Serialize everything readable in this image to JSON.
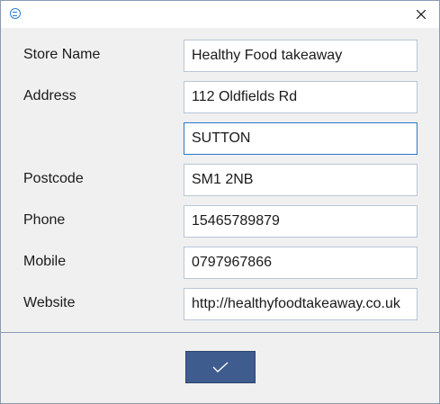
{
  "window": {
    "icon": "app-icon",
    "close_icon": "close-icon"
  },
  "form": {
    "store_name": {
      "label": "Store Name",
      "value": "Healthy Food takeaway"
    },
    "address": {
      "label": "Address",
      "value": "112 Oldfields Rd"
    },
    "address2": {
      "value": "SUTTON"
    },
    "postcode": {
      "label": "Postcode",
      "value": "SM1 2NB"
    },
    "phone": {
      "label": "Phone",
      "value": "15465789879"
    },
    "mobile": {
      "label": "Mobile",
      "value": "0797967866"
    },
    "website": {
      "label": "Website",
      "value": "http://healthyfoodtakeaway.co.uk"
    }
  },
  "footer": {
    "ok_icon": "checkmark-icon"
  },
  "colors": {
    "accent": "#3e5c8e",
    "focus_border": "#2a78c8",
    "input_border": "#b7c6d6"
  }
}
